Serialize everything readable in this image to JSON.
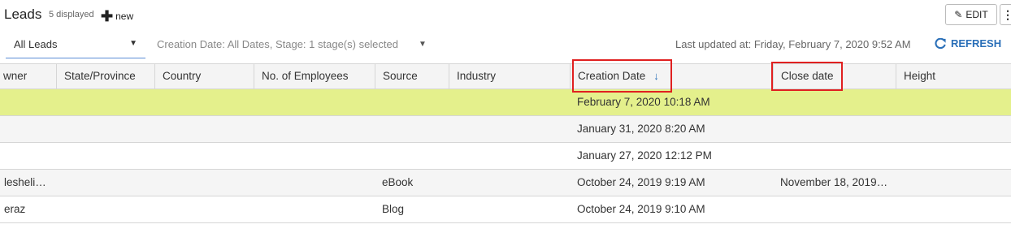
{
  "header": {
    "title": "Leads",
    "count_label": "5 displayed",
    "new_label": "new",
    "edit_label": "EDIT",
    "more_icon": "kebab-menu-icon"
  },
  "filters": {
    "view_selected": "All Leads",
    "criteria_text": "Creation Date: All Dates, Stage: 1 stage(s) selected",
    "last_updated": "Last updated at: Friday, February 7, 2020 9:52 AM",
    "refresh_label": "REFRESH"
  },
  "table": {
    "columns": [
      "wner",
      "State/Province",
      "Country",
      "No. of Employees",
      "Source",
      "Industry",
      "Creation Date",
      "Close date",
      "Height"
    ],
    "sorted_column": "Creation Date",
    "sort_direction": "descending",
    "highlighted_columns": [
      "Creation Date",
      "Close date"
    ],
    "rows": [
      {
        "owner": "",
        "state": "",
        "country": "",
        "employees": "",
        "source": "",
        "industry": "",
        "creation_date": "February 7, 2020 10:18 AM",
        "close_date": "",
        "height": ""
      },
      {
        "owner": "",
        "state": "",
        "country": "",
        "employees": "",
        "source": "",
        "industry": "",
        "creation_date": "January 31, 2020 8:20 AM",
        "close_date": "",
        "height": ""
      },
      {
        "owner": "",
        "state": "",
        "country": "",
        "employees": "",
        "source": "",
        "industry": "",
        "creation_date": "January 27, 2020 12:12 PM",
        "close_date": "",
        "height": ""
      },
      {
        "owner": "lesheli…",
        "state": "",
        "country": "",
        "employees": "",
        "source": "eBook",
        "industry": "",
        "creation_date": "October 24, 2019 9:19 AM",
        "close_date": "November 18, 2019…",
        "height": ""
      },
      {
        "owner": "eraz",
        "state": "",
        "country": "",
        "employees": "",
        "source": "Blog",
        "industry": "",
        "creation_date": "October 24, 2019 9:10 AM",
        "close_date": "",
        "height": ""
      }
    ]
  },
  "colors": {
    "selected_row": "#e4f08c",
    "accent": "#2a6fb8",
    "highlight_box": "#e02020"
  }
}
